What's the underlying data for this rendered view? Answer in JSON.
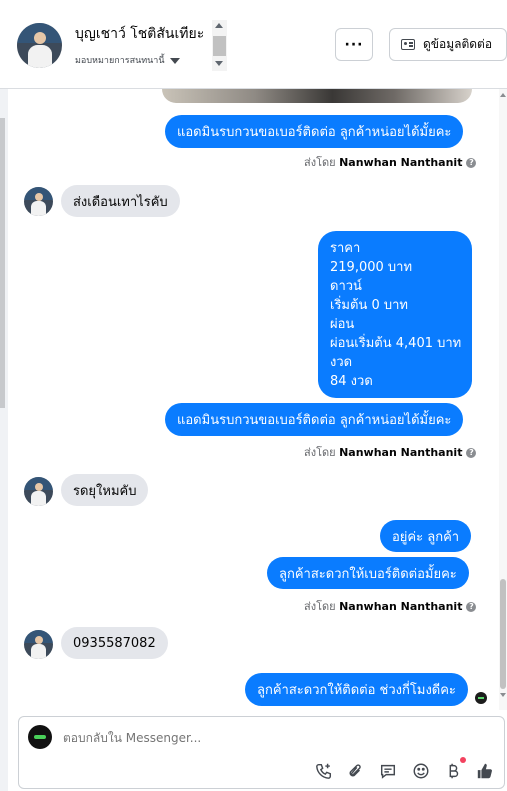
{
  "header": {
    "contact_name": "บุญเชาว์ โชติสันเทียะ",
    "assign_label": "มอบหมายการสนทนานี้",
    "more_label": "···",
    "view_contact_label": "ดูข้อมูลติดต่อ"
  },
  "thread": {
    "messages": [
      {
        "kind": "outgoing",
        "text": "แอดมินรบกวนขอเบอร์ติดต่อ ลูกค้าหน่อยได้มั้ยคะ"
      },
      {
        "kind": "sent_by",
        "prefix": "ส่งโดย",
        "name": "Nanwhan Nanthanit"
      },
      {
        "kind": "incoming",
        "text": "ส่งเดือนเทาไรคับ"
      },
      {
        "kind": "outgoing_multi",
        "lines": [
          "ราคา",
          "219,000 บาท",
          "ดาวน์",
          "เริ่มต้น 0 บาท",
          "ผ่อน",
          "ผ่อนเริ่มต้น 4,401 บาท",
          "งวด",
          "84 งวด"
        ]
      },
      {
        "kind": "outgoing",
        "text": "แอดมินรบกวนขอเบอร์ติดต่อ ลูกค้าหน่อยได้มั้ยคะ"
      },
      {
        "kind": "sent_by",
        "prefix": "ส่งโดย",
        "name": "Nanwhan Nanthanit"
      },
      {
        "kind": "incoming",
        "text": "รดยุใหมคับ"
      },
      {
        "kind": "outgoing",
        "text": "อยู่ค่ะ ลูกค้า"
      },
      {
        "kind": "outgoing",
        "text": "ลูกค้าสะดวกให้เบอร์ติดต่อมั้ยคะ"
      },
      {
        "kind": "sent_by",
        "prefix": "ส่งโดย",
        "name": "Nanwhan Nanthanit"
      },
      {
        "kind": "incoming",
        "text": "0935587082"
      },
      {
        "kind": "outgoing",
        "text": "ลูกค้าสะดวกให้ติดต่อ ช่วงกี่โมงดีคะ"
      }
    ]
  },
  "composer": {
    "placeholder": "ตอบกลับใน Messenger...",
    "tools": [
      "call-icon",
      "attach-icon",
      "saved-reply-icon",
      "emoji-icon",
      "payment-icon",
      "like-icon"
    ]
  },
  "colors": {
    "outgoing_bubble": "#0a7cff",
    "incoming_bubble": "#e4e6eb",
    "notification_dot": "#f3425f"
  }
}
